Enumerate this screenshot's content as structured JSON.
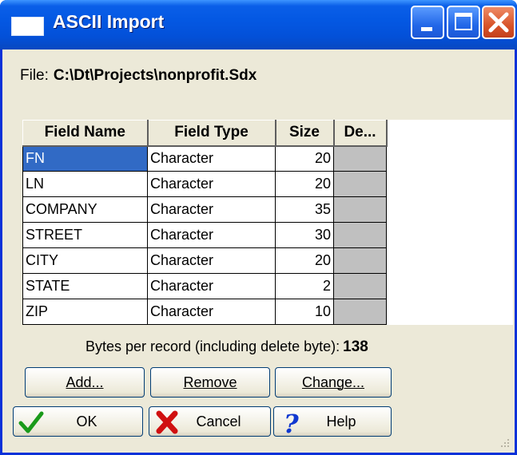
{
  "window": {
    "title": "ASCII Import"
  },
  "file": {
    "label": "File:",
    "path": "C:\\Dt\\Projects\\nonprofit.Sdx"
  },
  "grid": {
    "headers": [
      "Field Name",
      "Field Type",
      "Size",
      "De..."
    ],
    "rows": [
      {
        "name": "FN",
        "type": "Character",
        "size": "20"
      },
      {
        "name": "LN",
        "type": "Character",
        "size": "20"
      },
      {
        "name": "COMPANY",
        "type": "Character",
        "size": "35"
      },
      {
        "name": "STREET",
        "type": "Character",
        "size": "30"
      },
      {
        "name": "CITY",
        "type": "Character",
        "size": "20"
      },
      {
        "name": "STATE",
        "type": "Character",
        "size": "2"
      },
      {
        "name": "ZIP",
        "type": "Character",
        "size": "10"
      }
    ],
    "selected_row": 0
  },
  "summary": {
    "label": "Bytes per record (including delete byte):",
    "value": "138"
  },
  "buttons": {
    "add": "Add...",
    "remove": "Remove",
    "change": "Change...",
    "ok": "OK",
    "cancel": "Cancel",
    "help": "Help"
  },
  "colors": {
    "titlebar": "#0458e3",
    "dialog_bg": "#ece9d8",
    "selection": "#316ac5",
    "ok_check": "#1a9a1a",
    "cancel_x": "#d01010",
    "help_q": "#1038d0"
  },
  "icons": {
    "title": "window-icon",
    "ok": "checkmark-icon",
    "cancel": "x-icon",
    "help": "question-mark-icon"
  }
}
